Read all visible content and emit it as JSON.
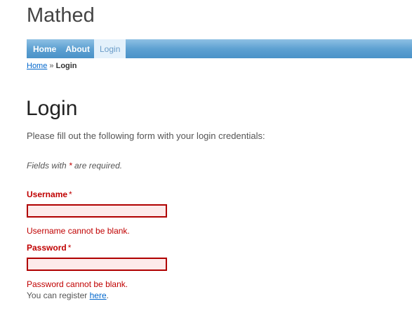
{
  "site": {
    "title": "Mathed"
  },
  "mainmenu": {
    "items": [
      {
        "label": "Home"
      },
      {
        "label": "About"
      },
      {
        "label": "Login"
      }
    ]
  },
  "breadcrumb": {
    "home": "Home",
    "separator": "»",
    "current": "Login"
  },
  "page": {
    "heading": "Login",
    "intro": "Please fill out the following form with your login credentials:",
    "required_prefix": "Fields with ",
    "required_star": "*",
    "required_suffix": " are required."
  },
  "form": {
    "username": {
      "label": "Username",
      "star": "*",
      "value": "",
      "error": "Username cannot be blank."
    },
    "password": {
      "label": "Password",
      "star": "*",
      "value": "",
      "error": "Password cannot be blank."
    },
    "register_prefix": "You can register ",
    "register_link": "here",
    "register_suffix": "."
  },
  "colors": {
    "menu_bar": "#5ea1d2",
    "error": "#c00000",
    "link": "#0066cc",
    "input_error_bg": "#fdeaea"
  }
}
